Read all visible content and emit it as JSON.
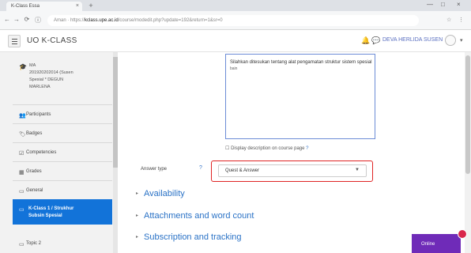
{
  "browser": {
    "tab_title": "K-Class Essa",
    "tab_close": "×",
    "new_tab": "+",
    "window_controls": [
      "—",
      "□",
      "×"
    ],
    "nav": [
      "←",
      "→",
      "⟳",
      "ⓘ"
    ],
    "url_prefix": "Aman · https://",
    "url_host": "kclass.upe.ac.id",
    "url_path": "/course/modedit.php?update=192&return=1&sr=0",
    "extensions": [
      "☆",
      "⋮"
    ]
  },
  "header": {
    "site_name": "UO K-CLASS",
    "notification_icon": "bell-icon",
    "message_icon": "chat-icon",
    "user_name": "DEVA HERLIDA SUSEN",
    "caret": "▾"
  },
  "sidebar": {
    "course": {
      "icon": "graduation-cap-icon",
      "lines": [
        "MA",
        "201920202014 (Susen",
        "Spesial * DEGUN",
        "MARLENA"
      ]
    },
    "items": [
      {
        "icon": "users-icon",
        "glyph": "👥",
        "label": "Participants"
      },
      {
        "icon": "badge-icon",
        "glyph": "🏷",
        "label": "Badges"
      },
      {
        "icon": "check-list-icon",
        "glyph": "☑",
        "label": "Competencies"
      },
      {
        "icon": "table-icon",
        "glyph": "▦",
        "label": "Grades"
      },
      {
        "icon": "folder-icon",
        "glyph": "▭",
        "label": "General"
      }
    ],
    "active": {
      "icon": "folder-icon",
      "glyph": "▭",
      "line1": "K-Class 1 / Strukhur",
      "line2": "Subsin Spesial"
    },
    "next": {
      "icon": "folder-icon",
      "glyph": "▭",
      "label": "Topic 2"
    }
  },
  "form": {
    "description_text": "Silahkan ditesukan tentang alat pengamatan struktur sistem spesial ",
    "description_tail": "bain",
    "display_description": "Display description on course page",
    "help_glyph": "?",
    "response_type_label": "Answer type",
    "required_glyph": "?",
    "response_type_value": "Quest & Answer",
    "select_arrow": "▼"
  },
  "sections": [
    {
      "label": "Availability"
    },
    {
      "label": "Attachments and word count"
    },
    {
      "label": "Subscription and tracking"
    }
  ],
  "section_glyph": "▸",
  "online": {
    "label": "Online"
  },
  "colors": {
    "accent": "#1273d9",
    "link": "#2a72c6",
    "highlight": "#e02424",
    "online_widget": "#6f2bb8",
    "badge": "#d9264b"
  }
}
